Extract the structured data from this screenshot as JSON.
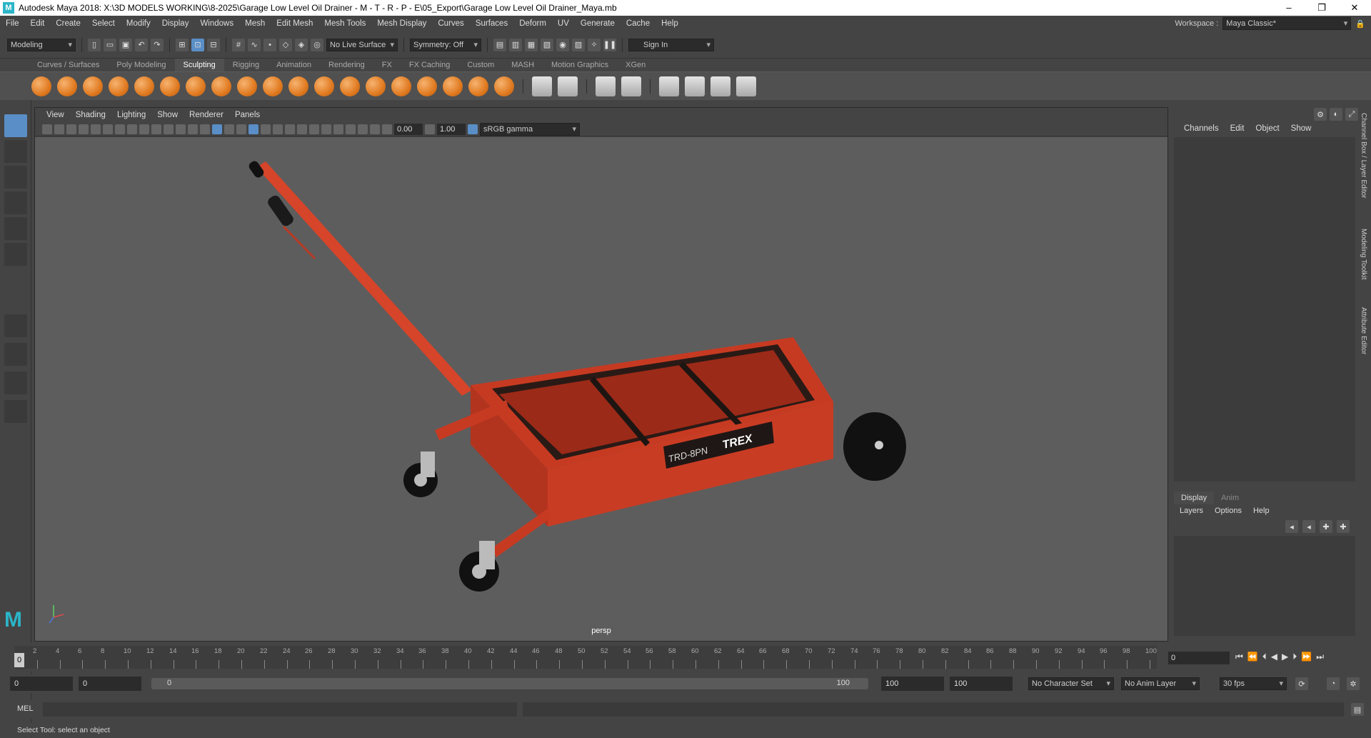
{
  "titlebar": {
    "title": "Autodesk Maya 2018: X:\\3D MODELS WORKING\\8-2025\\Garage Low Level Oil Drainer - M - T - R - P - E\\05_Export\\Garage Low Level Oil Drainer_Maya.mb",
    "minimize": "–",
    "maximize": "❐",
    "close": "✕"
  },
  "menubar": {
    "items": [
      "File",
      "Edit",
      "Create",
      "Select",
      "Modify",
      "Display",
      "Windows",
      "Mesh",
      "Edit Mesh",
      "Mesh Tools",
      "Mesh Display",
      "Curves",
      "Surfaces",
      "Deform",
      "UV",
      "Generate",
      "Cache",
      "Help"
    ],
    "workspace_label": "Workspace :",
    "workspace_value": "Maya Classic*"
  },
  "statusline": {
    "mode": "Modeling",
    "live_surface": "No Live Surface",
    "symmetry": "Symmetry: Off",
    "sign_in": "Sign In"
  },
  "shelf": {
    "tabs": [
      "Curves / Surfaces",
      "Poly Modeling",
      "Sculpting",
      "Rigging",
      "Animation",
      "Rendering",
      "FX",
      "FX Caching",
      "Custom",
      "MASH",
      "Motion Graphics",
      "XGen"
    ],
    "active_tab": "Sculpting"
  },
  "viewport": {
    "menu": [
      "View",
      "Shading",
      "Lighting",
      "Show",
      "Renderer",
      "Panels"
    ],
    "exposure": "0.00",
    "gamma": "1.00",
    "color_space": "sRGB gamma",
    "camera": "persp",
    "logo_text": "TRD-8PN",
    "brand_text": "TREX"
  },
  "channelbox": {
    "menu": [
      "Channels",
      "Edit",
      "Object",
      "Show"
    ]
  },
  "layereditor": {
    "tabs": [
      "Display",
      "Anim"
    ],
    "active_tab": "Display",
    "menu": [
      "Layers",
      "Options",
      "Help"
    ]
  },
  "sidetabs": [
    "Channel Box / Layer Editor",
    "Modeling Toolkit",
    "Attribute Editor"
  ],
  "timeslider": {
    "ticks": [
      "2",
      "4",
      "6",
      "8",
      "10",
      "12",
      "14",
      "16",
      "18",
      "20",
      "22",
      "24",
      "26",
      "28",
      "30",
      "32",
      "34",
      "36",
      "38",
      "40",
      "42",
      "44",
      "46",
      "48",
      "50",
      "52",
      "54",
      "56",
      "58",
      "60",
      "62",
      "64",
      "66",
      "68",
      "70",
      "72",
      "74",
      "76",
      "78",
      "80",
      "82",
      "84",
      "86",
      "88",
      "90",
      "92",
      "94",
      "96",
      "98",
      "100"
    ],
    "current_frame": "0",
    "frame_field": "0"
  },
  "rangebar": {
    "start": "0",
    "anim_start": "0",
    "range_start": "0",
    "range_end": "100",
    "playback_end": "100",
    "anim_end": "100",
    "character_set": "No Character Set",
    "anim_layer": "No Anim Layer",
    "fps": "30 fps"
  },
  "cmdline": {
    "label": "MEL"
  },
  "helpline": {
    "text": "Select Tool: select an object"
  }
}
